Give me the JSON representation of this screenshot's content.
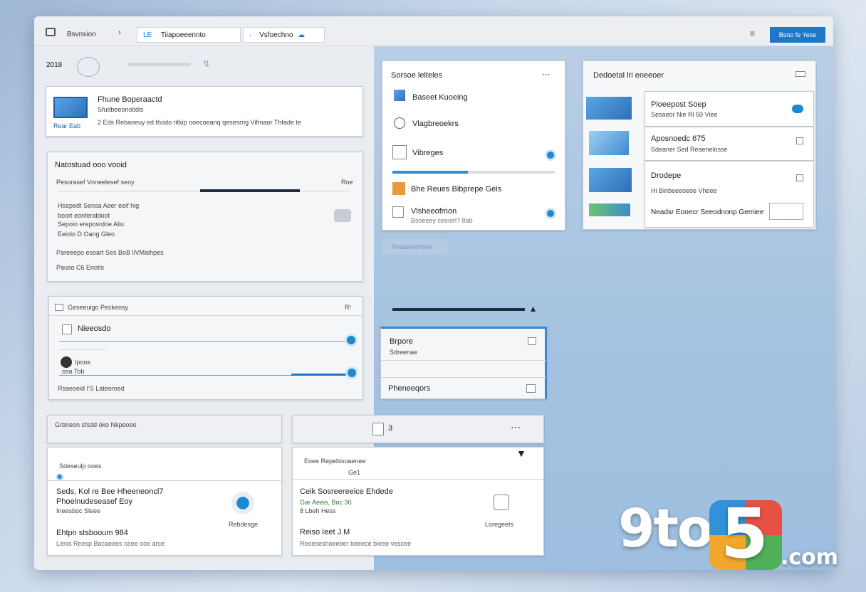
{
  "titlebar": {
    "app_label": "Bsvnsion",
    "tab1": "Tiiapoeeennto",
    "tab2": "Vsfoechno",
    "tab1_prefix": "LÉ",
    "tab2_prefix": "·",
    "button": "Bsno fe Yese"
  },
  "left": {
    "header_label": "2018",
    "card1": {
      "title": "Fhune Boperaactd",
      "subtitle": "Sfudbeeonotldis",
      "tag": "Rear Eab",
      "desc": "2 Eds Rebaneuy ed thodo ritkip ooecoeanq qesesrrig Vifmaor Thfade te"
    },
    "card2": {
      "title": "Natostuad ooo vooid",
      "row1": "Pesorasef Vnneelesef seoy",
      "row1_end": "Roe",
      "list": [
        "Hsepedt Sensa Aeer eeif hig",
        "boort eonferaldoot",
        "Sepoin ereposrdoe Aliu",
        "Eeiolo D Oang Gleo"
      ],
      "row2": "Pareeepo esoart Ses BoB liVMalhpes",
      "foot": "Pauso C6 Enotis"
    },
    "card3": {
      "header": "Geseeuigo Peckeosy",
      "header_end": "R!",
      "item1": "Nieeosdo",
      "item2": "Ipoos",
      "item2_sub": "osa Tob",
      "foot": "Rsaeoeid I'S Lateoroed"
    },
    "card4": {
      "header": "Grbneon sfsdd oko Nkpeoeo"
    },
    "card5": {
      "label": "Sdeseulp ooes",
      "row1": "Seds, Kol re Bee Hheeneoncl7",
      "row2": "Phoelnudeseasef Eoy",
      "row3": "Ineesboc Sleee",
      "side": "Rehdesge",
      "foot": "Ehtpn stsbooum 984",
      "foot2": "Lenis Reesp Bacaeees ceee ooe arce"
    }
  },
  "middle": {
    "card1": {
      "title": "Sorsoe lelteles",
      "items": [
        "Baseet Kuoeing",
        "Vlagbreoekrs",
        "Vibreges",
        "Bhe Reues Bibprepe Geis",
        "Vlsheeofmon"
      ],
      "item5_sub": "Bsoeeey ceeoin? 8ab"
    },
    "btn_ghost": "Poaleeiidnoes",
    "card2": {
      "item1": "Brpore",
      "item1_sub": "Sdreenae",
      "item2": "Pheneeqors"
    },
    "card3": {
      "label": "3"
    },
    "card4": {
      "header": "Eoee Repebisoaenee",
      "header_sub": "Ge1",
      "title": "Ceik Sosreereeice Ehdede",
      "sub1": "Gar Aeeis, Boc 30",
      "sub2": "8 Lbeh Hess",
      "side": "Loregeets",
      "foot": "Reiso Ieet J.M",
      "foot2": "Reoeseshoeeeer beeece bleee vescee"
    }
  },
  "right": {
    "card": {
      "title": "Dedoetal lri eneeoer",
      "items": [
        {
          "title": "Pioeepost Soep",
          "sub": "Sesaeor Nie Rl 50 Viee"
        },
        {
          "title": "Aposnoedc 675",
          "sub": "Sdeaner Sed Reaenelosse"
        },
        {
          "title": "Drodepe",
          "sub": "Hi Binbeeeoeoe Vheee"
        }
      ],
      "footer": "Neadsr Eooecr Seeodnonp Gemiee"
    }
  },
  "watermark": {
    "part1": "9to",
    "part2": "5",
    "part3": ".com"
  },
  "colors": {
    "accent": "#1e78c8",
    "pane": "#a6c3e0"
  }
}
